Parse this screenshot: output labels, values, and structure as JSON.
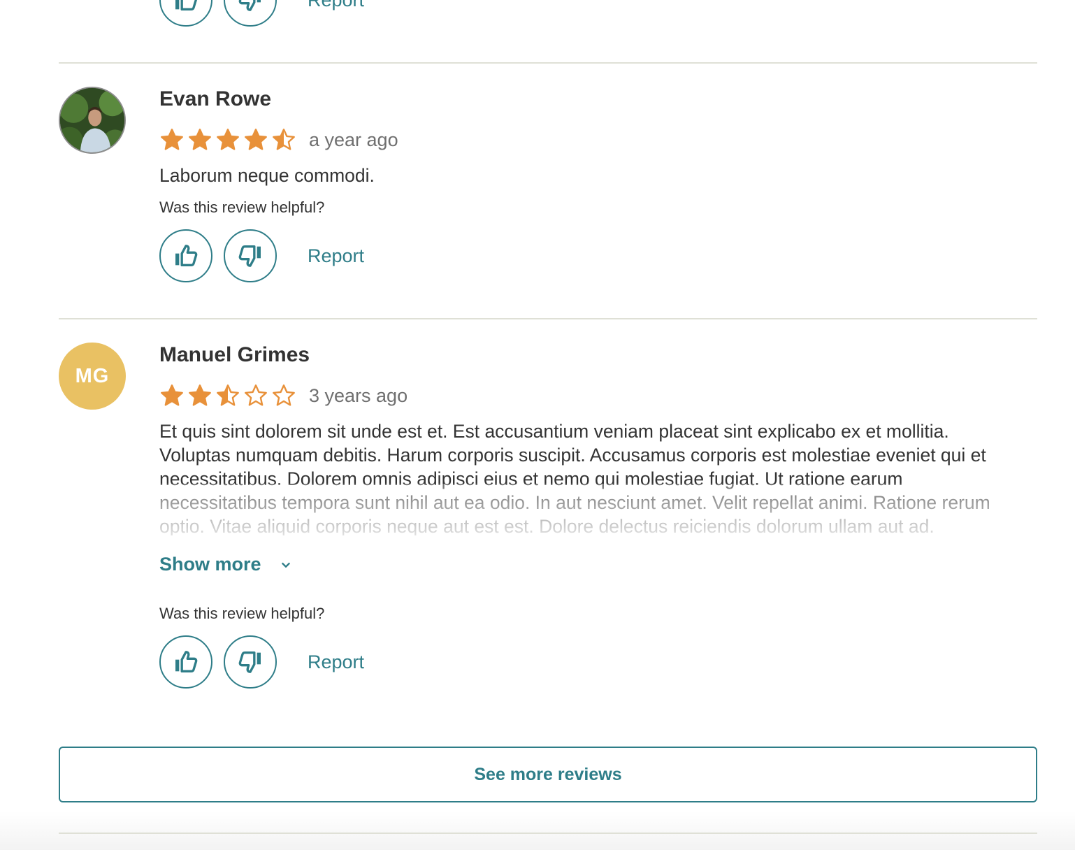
{
  "previous_review": {
    "report_label": "Report"
  },
  "reviews": [
    {
      "name": "Evan Rowe",
      "avatar_type": "photo",
      "rating": 4.5,
      "time": "a year ago",
      "body": "Laborum neque commodi.",
      "helpful_prompt": "Was this review helpful?",
      "report_label": "Report"
    },
    {
      "name": "Manuel Grimes",
      "avatar_type": "initials",
      "initials": "MG",
      "rating": 2.5,
      "time": "3 years ago",
      "body": "Et quis sint dolorem sit unde est et. Est accusantium veniam placeat sint explicabo ex et mollitia. Voluptas numquam debitis. Harum corporis suscipit. Accusamus corporis est molestiae eveniet qui et necessitatibus. Dolorem omnis adipisci eius et nemo qui molestiae fugiat. Ut ratione earum necessitatibus tempora sunt nihil aut ea odio. In aut nesciunt amet. Velit repellat animi. Ratione rerum optio. Vitae aliquid corporis neque aut est est. Dolore delectus reiciendis dolorum ullam aut ad. Dolorem quae est reiciendis quis. Assumenda nisi",
      "show_more_label": "Show more",
      "helpful_prompt": "Was this review helpful?",
      "report_label": "Report"
    }
  ],
  "see_more_label": "See more reviews",
  "colors": {
    "accent": "#2e7d88",
    "star": "#e8913a",
    "initials_avatar": "#e9c163",
    "divider": "#dfe0d6"
  },
  "icons": [
    "thumbs-up-icon",
    "thumbs-down-icon",
    "star-icon",
    "chevron-down-icon"
  ]
}
